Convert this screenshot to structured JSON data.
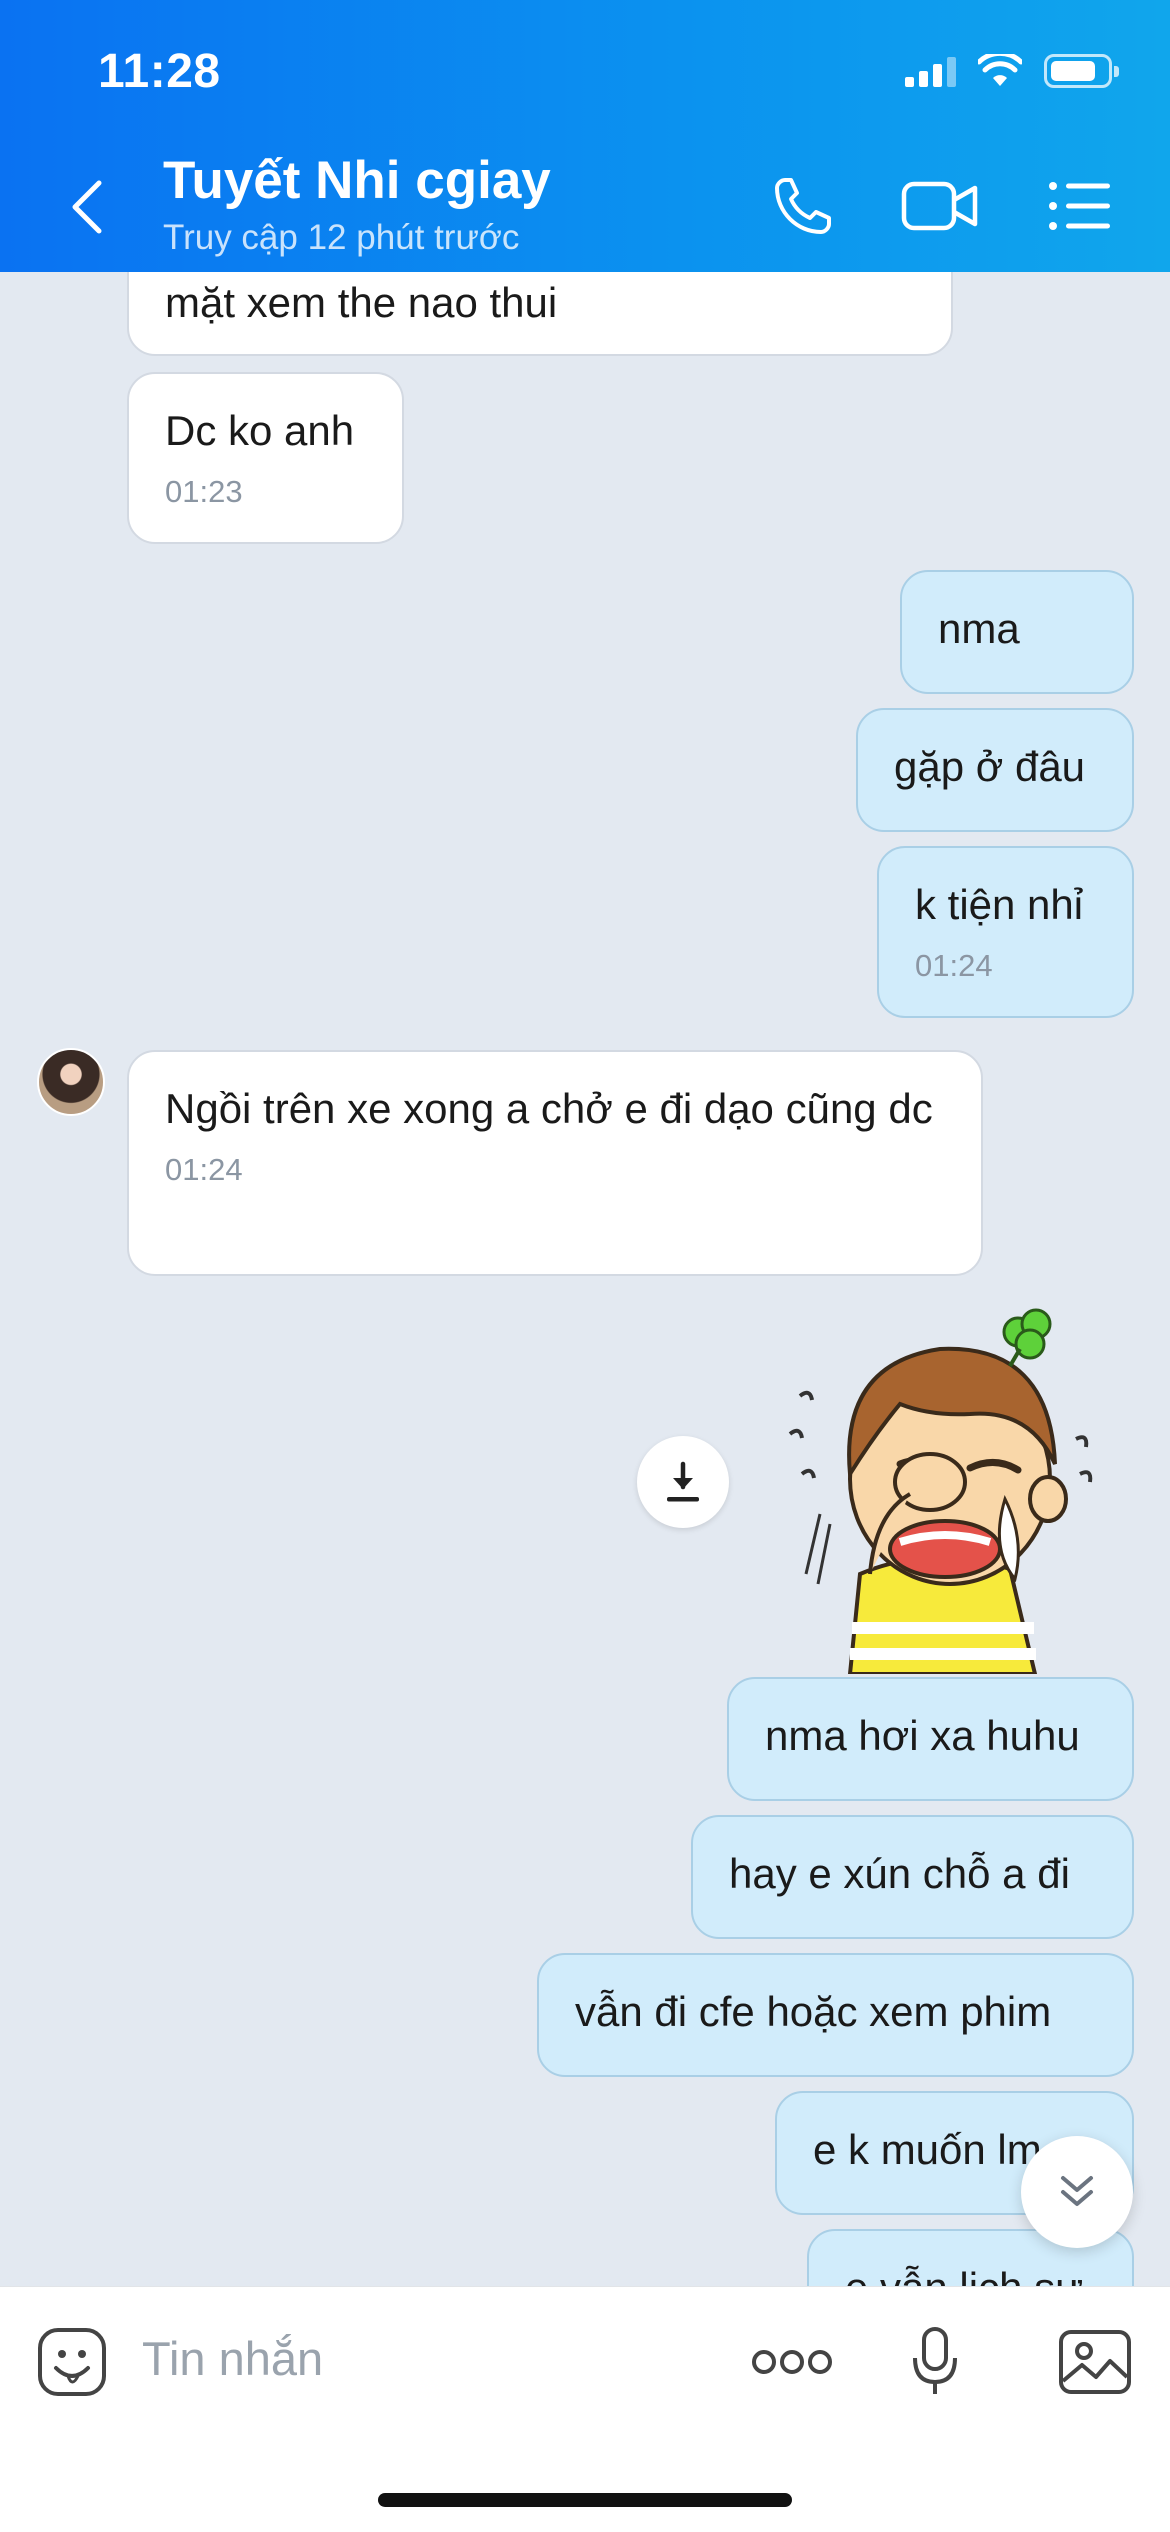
{
  "status_bar": {
    "time": "11:28"
  },
  "header": {
    "contact_name": "Tuyết Nhi cgiay",
    "last_seen": "Truy cập 12 phút trước"
  },
  "messages": [
    {
      "side": "in",
      "text": "mặt xem the nao thui"
    },
    {
      "side": "in",
      "text": "Dc ko anh",
      "time": "01:23"
    },
    {
      "side": "out",
      "text": "nma"
    },
    {
      "side": "out",
      "text": "gặp ở đâu"
    },
    {
      "side": "out",
      "text": "k tiện nhỉ",
      "time": "01:24"
    },
    {
      "side": "in",
      "text": "Ngồi trên xe xong a chở e đi dạo cũng dc",
      "time": "01:24"
    },
    {
      "side": "out",
      "type": "sticker",
      "sticker": "crying-boy-sticker"
    },
    {
      "side": "out",
      "text": "nma hơi xa huhu"
    },
    {
      "side": "out",
      "text": "hay e xún chỗ a đi"
    },
    {
      "side": "out",
      "text": "vẫn đi cfe hoặc xem phim"
    },
    {
      "side": "out",
      "text": "e k muốn lm"
    },
    {
      "side": "out",
      "text": "e vẫn lịch sự"
    }
  ],
  "input": {
    "placeholder": "Tin nhắn"
  },
  "colors": {
    "header_start": "#0a72f2",
    "header_end": "#10a6ec",
    "chat_background": "#e3e9f1",
    "outgoing_bubble": "#d1ecfb",
    "incoming_bubble": "#ffffff"
  },
  "icons": [
    "back-icon",
    "phone-icon",
    "video-call-icon",
    "menu-list-icon",
    "download-icon",
    "scroll-down-icon",
    "emoji-icon",
    "more-icon",
    "microphone-icon",
    "image-icon"
  ]
}
